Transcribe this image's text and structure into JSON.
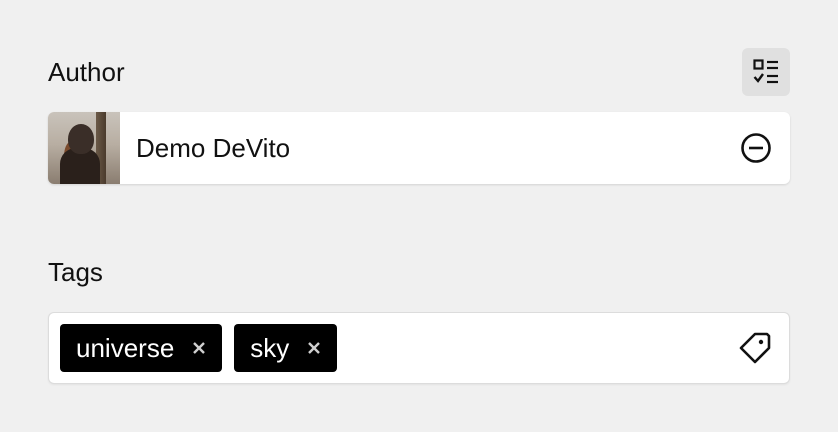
{
  "author": {
    "title": "Author",
    "toggle_icon": "list-checks-icon",
    "selected": {
      "name": "Demo DeVito",
      "avatar": "avatar-photo",
      "remove_icon": "minus-circle-icon"
    }
  },
  "tags": {
    "title": "Tags",
    "items": [
      {
        "label": "universe",
        "remove_icon": "close-icon"
      },
      {
        "label": "sky",
        "remove_icon": "close-icon"
      }
    ],
    "field_icon": "tag-icon"
  },
  "colors": {
    "background": "#f0f0f0",
    "tag_bg": "#000000",
    "tag_text": "#ffffff",
    "toggle_bg": "#e0e0e0"
  }
}
